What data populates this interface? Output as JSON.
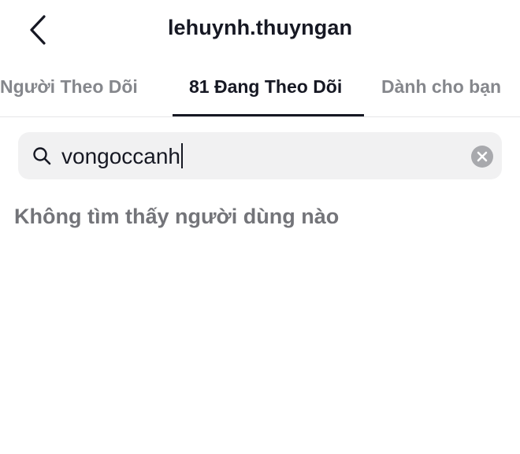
{
  "header": {
    "back_icon": "chevron-left-icon",
    "title": "lehuynh.thuyngan"
  },
  "tabs": [
    {
      "label": "Người Theo Dõi",
      "active": false
    },
    {
      "label": "81 Đang Theo Dõi",
      "active": true
    },
    {
      "label": "Dành cho bạn",
      "active": false
    }
  ],
  "search": {
    "icon": "search-icon",
    "value": "vongoccanh",
    "clear_icon": "clear-icon"
  },
  "results": {
    "empty_message": "Không tìm thấy người dùng nào"
  },
  "colors": {
    "text_primary": "#161823",
    "text_secondary": "#85878c",
    "search_bg": "#f1f1f2",
    "divider": "#e6e6e8"
  }
}
